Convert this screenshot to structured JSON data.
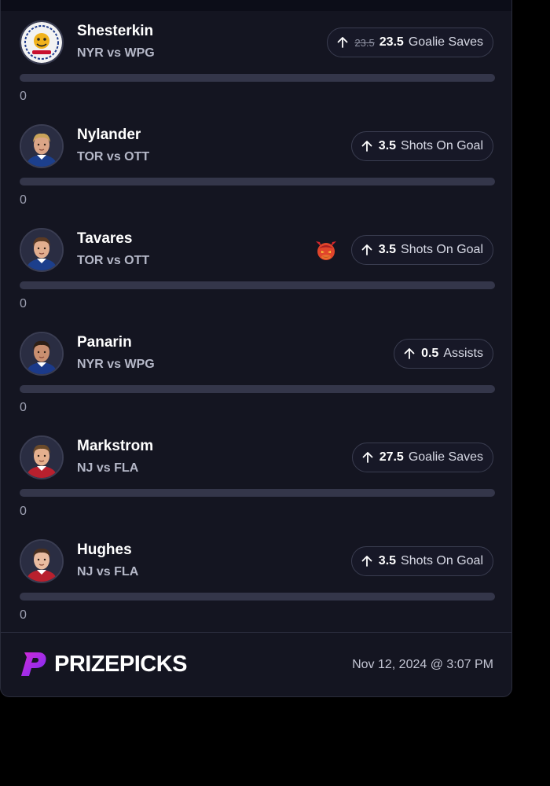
{
  "brand": {
    "name": "PRIZEPICKS",
    "accent_color": "#8b2cf5",
    "secondary_color": "#d22bd6"
  },
  "picks": [
    {
      "player": "Shesterkin",
      "matchup": "NYR vs WPG",
      "direction": "up-arrow-icon",
      "old_line": "23.5",
      "line": "23.5",
      "stat": "Goalie Saves",
      "progress": 0,
      "progress_fraction": 0,
      "avatar_icon": "team-logo-avatar",
      "demon": false
    },
    {
      "player": "Nylander",
      "matchup": "TOR vs OTT",
      "direction": "up-arrow-icon",
      "old_line": "",
      "line": "3.5",
      "stat": "Shots On Goal",
      "progress": 0,
      "progress_fraction": 0,
      "avatar_icon": "player-headshot",
      "demon": false
    },
    {
      "player": "Tavares",
      "matchup": "TOR vs OTT",
      "direction": "up-arrow-icon",
      "old_line": "",
      "line": "3.5",
      "stat": "Shots On Goal",
      "progress": 0,
      "progress_fraction": 0,
      "avatar_icon": "player-headshot",
      "demon": true
    },
    {
      "player": "Panarin",
      "matchup": "NYR vs WPG",
      "direction": "up-arrow-icon",
      "old_line": "",
      "line": "0.5",
      "stat": "Assists",
      "progress": 0,
      "progress_fraction": 0,
      "avatar_icon": "player-headshot",
      "demon": false
    },
    {
      "player": "Markstrom",
      "matchup": "NJ vs FLA",
      "direction": "up-arrow-icon",
      "old_line": "",
      "line": "27.5",
      "stat": "Goalie Saves",
      "progress": 0,
      "progress_fraction": 0,
      "avatar_icon": "player-headshot",
      "demon": false
    },
    {
      "player": "Hughes",
      "matchup": "NJ vs FLA",
      "direction": "up-arrow-icon",
      "old_line": "",
      "line": "3.5",
      "stat": "Shots On Goal",
      "progress": 0,
      "progress_fraction": 0,
      "avatar_icon": "player-headshot",
      "demon": false
    }
  ],
  "footer": {
    "timestamp": "Nov 12, 2024 @ 3:07 PM"
  },
  "colors": {
    "card_bg": "#141521",
    "bar_track": "#34364a",
    "pill_border": "#3a3d50"
  }
}
